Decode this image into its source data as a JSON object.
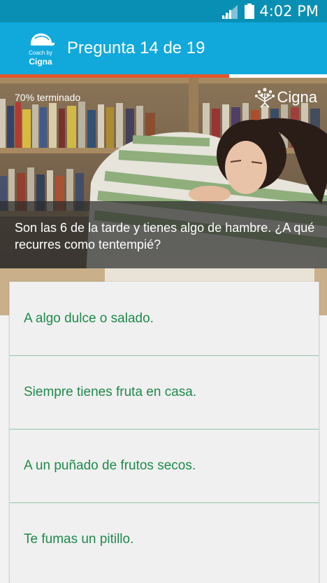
{
  "status_bar": {
    "time": "4:02 PM"
  },
  "app_bar": {
    "logo_line1": "Coach by",
    "logo_line2": "Cigna",
    "title": "Pregunta 14 de 19"
  },
  "progress": {
    "fraction": 0.7
  },
  "hero": {
    "completed_label": "70% terminado",
    "brand": "Cigna",
    "question": "Son las 6 de la tarde y tienes algo de hambre. ¿A qué recurres como tentempié?"
  },
  "answers": [
    {
      "label": "A algo dulce o salado."
    },
    {
      "label": "Siempre tienes fruta en casa."
    },
    {
      "label": "A un puñado de frutos secos."
    },
    {
      "label": "Te fumas un pitillo."
    }
  ],
  "colors": {
    "status_bar": "#0a8fb4",
    "app_bar": "#11a9dc",
    "progress": "#e2572c",
    "answer_text": "#1f8a4c",
    "divider": "#8fc7a9"
  }
}
